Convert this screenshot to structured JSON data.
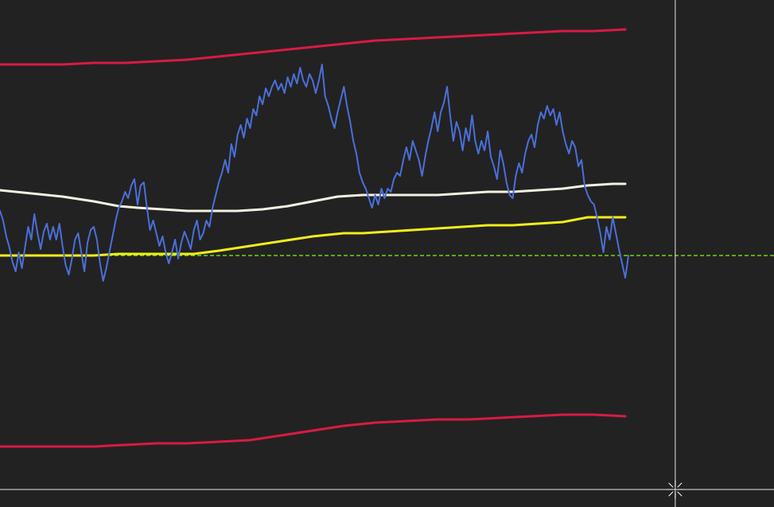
{
  "chart_data": {
    "type": "line",
    "title": "",
    "xlabel": "",
    "ylabel": "",
    "grid": false,
    "legend": "none",
    "x_range": [
      0,
      100
    ],
    "y_range": [
      -1.5,
      1.6
    ],
    "reference_line": {
      "value": 0.0,
      "style": "dashed",
      "color": "#7CFC00"
    },
    "crosshair": {
      "x": 108,
      "y": -1.47,
      "color": "#e6e6e6"
    },
    "crosshair_cursor_icon": "crosshair-cursor-icon",
    "series": [
      {
        "color": "#f4f1df",
        "width": 3,
        "points": [
          [
            0,
            0.41
          ],
          [
            5,
            0.39
          ],
          [
            10,
            0.37
          ],
          [
            15,
            0.34
          ],
          [
            19,
            0.31
          ],
          [
            22,
            0.3
          ],
          [
            26,
            0.29
          ],
          [
            30,
            0.28
          ],
          [
            34,
            0.28
          ],
          [
            38,
            0.28
          ],
          [
            42,
            0.29
          ],
          [
            46,
            0.31
          ],
          [
            50,
            0.34
          ],
          [
            54,
            0.37
          ],
          [
            58,
            0.38
          ],
          [
            62,
            0.38
          ],
          [
            66,
            0.38
          ],
          [
            70,
            0.38
          ],
          [
            74,
            0.39
          ],
          [
            78,
            0.4
          ],
          [
            82,
            0.4
          ],
          [
            86,
            0.41
          ],
          [
            90,
            0.42
          ],
          [
            94,
            0.44
          ],
          [
            98,
            0.45
          ],
          [
            100,
            0.45
          ]
        ]
      },
      {
        "color": "#f3ec1b",
        "width": 3,
        "points": [
          [
            0,
            0.0
          ],
          [
            5,
            0.0
          ],
          [
            10,
            0.0
          ],
          [
            15,
            0.0
          ],
          [
            19,
            0.01
          ],
          [
            23,
            0.01
          ],
          [
            27,
            0.01
          ],
          [
            31,
            0.01
          ],
          [
            35,
            0.03
          ],
          [
            40,
            0.06
          ],
          [
            45,
            0.09
          ],
          [
            50,
            0.12
          ],
          [
            55,
            0.14
          ],
          [
            58,
            0.14
          ],
          [
            62,
            0.15
          ],
          [
            66,
            0.16
          ],
          [
            70,
            0.17
          ],
          [
            74,
            0.18
          ],
          [
            78,
            0.19
          ],
          [
            82,
            0.19
          ],
          [
            86,
            0.2
          ],
          [
            90,
            0.21
          ],
          [
            94,
            0.24
          ],
          [
            97,
            0.24
          ],
          [
            100,
            0.24
          ]
        ]
      },
      {
        "color": "#d81b43",
        "width": 3,
        "points": [
          [
            0,
            1.2
          ],
          [
            5,
            1.2
          ],
          [
            10,
            1.2
          ],
          [
            15,
            1.21
          ],
          [
            20,
            1.21
          ],
          [
            25,
            1.22
          ],
          [
            30,
            1.23
          ],
          [
            35,
            1.25
          ],
          [
            40,
            1.27
          ],
          [
            45,
            1.29
          ],
          [
            50,
            1.31
          ],
          [
            55,
            1.33
          ],
          [
            60,
            1.35
          ],
          [
            65,
            1.36
          ],
          [
            70,
            1.37
          ],
          [
            75,
            1.38
          ],
          [
            80,
            1.39
          ],
          [
            85,
            1.4
          ],
          [
            90,
            1.41
          ],
          [
            95,
            1.41
          ],
          [
            100,
            1.42
          ]
        ]
      },
      {
        "color": "#d81b43",
        "width": 3,
        "points": [
          [
            0,
            -1.2
          ],
          [
            5,
            -1.2
          ],
          [
            10,
            -1.2
          ],
          [
            15,
            -1.2
          ],
          [
            20,
            -1.19
          ],
          [
            25,
            -1.18
          ],
          [
            30,
            -1.18
          ],
          [
            35,
            -1.17
          ],
          [
            40,
            -1.16
          ],
          [
            45,
            -1.13
          ],
          [
            50,
            -1.1
          ],
          [
            55,
            -1.07
          ],
          [
            60,
            -1.05
          ],
          [
            65,
            -1.04
          ],
          [
            70,
            -1.03
          ],
          [
            75,
            -1.03
          ],
          [
            80,
            -1.02
          ],
          [
            85,
            -1.01
          ],
          [
            90,
            -1.0
          ],
          [
            95,
            -1.0
          ],
          [
            100,
            -1.01
          ]
        ]
      },
      {
        "color": "#4b6fd8",
        "width": 2,
        "points": [
          [
            0.0,
            0.28
          ],
          [
            0.5,
            0.22
          ],
          [
            1.0,
            0.12
          ],
          [
            1.5,
            0.05
          ],
          [
            2.0,
            -0.04
          ],
          [
            2.5,
            -0.1
          ],
          [
            3.0,
            0.02
          ],
          [
            3.5,
            -0.08
          ],
          [
            4.0,
            0.05
          ],
          [
            4.5,
            0.18
          ],
          [
            5.0,
            0.1
          ],
          [
            5.5,
            0.26
          ],
          [
            6.0,
            0.14
          ],
          [
            6.5,
            0.04
          ],
          [
            7.0,
            0.15
          ],
          [
            7.5,
            0.2
          ],
          [
            8.0,
            0.1
          ],
          [
            8.5,
            0.18
          ],
          [
            9.0,
            0.1
          ],
          [
            9.5,
            0.2
          ],
          [
            10.0,
            0.06
          ],
          [
            10.5,
            -0.06
          ],
          [
            11.0,
            -0.12
          ],
          [
            11.5,
            -0.02
          ],
          [
            12.0,
            0.1
          ],
          [
            12.5,
            0.14
          ],
          [
            13.0,
            0.02
          ],
          [
            13.5,
            -0.1
          ],
          [
            14.0,
            0.08
          ],
          [
            14.5,
            0.16
          ],
          [
            15.0,
            0.18
          ],
          [
            15.5,
            0.1
          ],
          [
            16.0,
            -0.05
          ],
          [
            16.5,
            -0.16
          ],
          [
            17.0,
            -0.08
          ],
          [
            17.5,
            0.02
          ],
          [
            18.0,
            0.12
          ],
          [
            18.5,
            0.22
          ],
          [
            19.0,
            0.3
          ],
          [
            19.5,
            0.34
          ],
          [
            20.0,
            0.4
          ],
          [
            20.5,
            0.36
          ],
          [
            21.0,
            0.44
          ],
          [
            21.5,
            0.48
          ],
          [
            22.0,
            0.32
          ],
          [
            22.5,
            0.44
          ],
          [
            23.0,
            0.46
          ],
          [
            23.5,
            0.3
          ],
          [
            24.0,
            0.16
          ],
          [
            24.5,
            0.22
          ],
          [
            25.0,
            0.14
          ],
          [
            25.5,
            0.06
          ],
          [
            26.0,
            0.12
          ],
          [
            26.5,
            0.02
          ],
          [
            27.0,
            -0.05
          ],
          [
            27.5,
            0.02
          ],
          [
            28.0,
            0.1
          ],
          [
            28.5,
            -0.02
          ],
          [
            29.0,
            0.08
          ],
          [
            29.5,
            0.15
          ],
          [
            30.0,
            0.1
          ],
          [
            30.5,
            0.04
          ],
          [
            31.0,
            0.16
          ],
          [
            31.5,
            0.22
          ],
          [
            32.0,
            0.1
          ],
          [
            32.5,
            0.14
          ],
          [
            33.0,
            0.22
          ],
          [
            33.5,
            0.18
          ],
          [
            34.0,
            0.3
          ],
          [
            34.5,
            0.38
          ],
          [
            35.0,
            0.46
          ],
          [
            35.5,
            0.52
          ],
          [
            36.0,
            0.6
          ],
          [
            36.5,
            0.52
          ],
          [
            37.0,
            0.7
          ],
          [
            37.5,
            0.62
          ],
          [
            38.0,
            0.76
          ],
          [
            38.5,
            0.82
          ],
          [
            39.0,
            0.74
          ],
          [
            39.5,
            0.86
          ],
          [
            40.0,
            0.8
          ],
          [
            40.5,
            0.92
          ],
          [
            41.0,
            0.88
          ],
          [
            41.5,
            1.0
          ],
          [
            42.0,
            0.95
          ],
          [
            42.5,
            1.05
          ],
          [
            43.0,
            1.0
          ],
          [
            43.5,
            1.06
          ],
          [
            44.0,
            1.1
          ],
          [
            44.5,
            1.04
          ],
          [
            45.0,
            1.08
          ],
          [
            45.5,
            1.02
          ],
          [
            46.0,
            1.12
          ],
          [
            46.5,
            1.06
          ],
          [
            47.0,
            1.14
          ],
          [
            47.5,
            1.08
          ],
          [
            48.0,
            1.18
          ],
          [
            48.5,
            1.1
          ],
          [
            49.0,
            1.06
          ],
          [
            49.5,
            1.14
          ],
          [
            50.0,
            1.1
          ],
          [
            50.5,
            1.02
          ],
          [
            51.0,
            1.1
          ],
          [
            51.5,
            1.2
          ],
          [
            52.0,
            1.0
          ],
          [
            52.5,
            0.94
          ],
          [
            53.0,
            0.86
          ],
          [
            53.5,
            0.8
          ],
          [
            54.0,
            0.9
          ],
          [
            54.5,
            0.98
          ],
          [
            55.0,
            1.06
          ],
          [
            55.5,
            0.94
          ],
          [
            56.0,
            0.84
          ],
          [
            56.5,
            0.72
          ],
          [
            57.0,
            0.64
          ],
          [
            57.5,
            0.52
          ],
          [
            58.0,
            0.46
          ],
          [
            58.5,
            0.42
          ],
          [
            59.0,
            0.36
          ],
          [
            59.5,
            0.3
          ],
          [
            60.0,
            0.38
          ],
          [
            60.5,
            0.32
          ],
          [
            61.0,
            0.42
          ],
          [
            61.5,
            0.36
          ],
          [
            62.0,
            0.42
          ],
          [
            62.5,
            0.4
          ],
          [
            63.0,
            0.48
          ],
          [
            63.5,
            0.52
          ],
          [
            64.0,
            0.5
          ],
          [
            64.5,
            0.6
          ],
          [
            65.0,
            0.68
          ],
          [
            65.5,
            0.6
          ],
          [
            66.0,
            0.72
          ],
          [
            66.5,
            0.66
          ],
          [
            67.0,
            0.6
          ],
          [
            67.5,
            0.5
          ],
          [
            68.0,
            0.62
          ],
          [
            68.5,
            0.72
          ],
          [
            69.0,
            0.8
          ],
          [
            69.5,
            0.9
          ],
          [
            70.0,
            0.78
          ],
          [
            70.5,
            0.9
          ],
          [
            71.0,
            0.96
          ],
          [
            71.5,
            1.06
          ],
          [
            72.0,
            0.88
          ],
          [
            72.5,
            0.72
          ],
          [
            73.0,
            0.84
          ],
          [
            73.5,
            0.78
          ],
          [
            74.0,
            0.66
          ],
          [
            74.5,
            0.8
          ],
          [
            75.0,
            0.72
          ],
          [
            75.5,
            0.88
          ],
          [
            76.0,
            0.72
          ],
          [
            76.5,
            0.64
          ],
          [
            77.0,
            0.72
          ],
          [
            77.5,
            0.66
          ],
          [
            78.0,
            0.78
          ],
          [
            78.5,
            0.62
          ],
          [
            79.0,
            0.56
          ],
          [
            79.5,
            0.48
          ],
          [
            80.0,
            0.66
          ],
          [
            80.5,
            0.58
          ],
          [
            81.0,
            0.46
          ],
          [
            81.5,
            0.38
          ],
          [
            82.0,
            0.36
          ],
          [
            82.5,
            0.5
          ],
          [
            83.0,
            0.58
          ],
          [
            83.5,
            0.52
          ],
          [
            84.0,
            0.64
          ],
          [
            84.5,
            0.72
          ],
          [
            85.0,
            0.76
          ],
          [
            85.5,
            0.68
          ],
          [
            86.0,
            0.82
          ],
          [
            86.5,
            0.9
          ],
          [
            87.0,
            0.86
          ],
          [
            87.5,
            0.94
          ],
          [
            88.0,
            0.88
          ],
          [
            88.5,
            0.92
          ],
          [
            89.0,
            0.82
          ],
          [
            89.5,
            0.9
          ],
          [
            90.0,
            0.78
          ],
          [
            90.5,
            0.7
          ],
          [
            91.0,
            0.64
          ],
          [
            91.5,
            0.72
          ],
          [
            92.0,
            0.68
          ],
          [
            92.5,
            0.56
          ],
          [
            93.0,
            0.6
          ],
          [
            93.5,
            0.44
          ],
          [
            94.0,
            0.38
          ],
          [
            94.5,
            0.34
          ],
          [
            95.0,
            0.32
          ],
          [
            95.5,
            0.24
          ],
          [
            96.0,
            0.14
          ],
          [
            96.5,
            0.02
          ],
          [
            97.0,
            0.18
          ],
          [
            97.5,
            0.1
          ],
          [
            98.0,
            0.24
          ],
          [
            98.5,
            0.14
          ],
          [
            99.0,
            0.04
          ],
          [
            99.5,
            -0.05
          ],
          [
            100.0,
            -0.14
          ],
          [
            100.3,
            -0.06
          ],
          [
            100.5,
            0.0
          ]
        ]
      }
    ]
  }
}
